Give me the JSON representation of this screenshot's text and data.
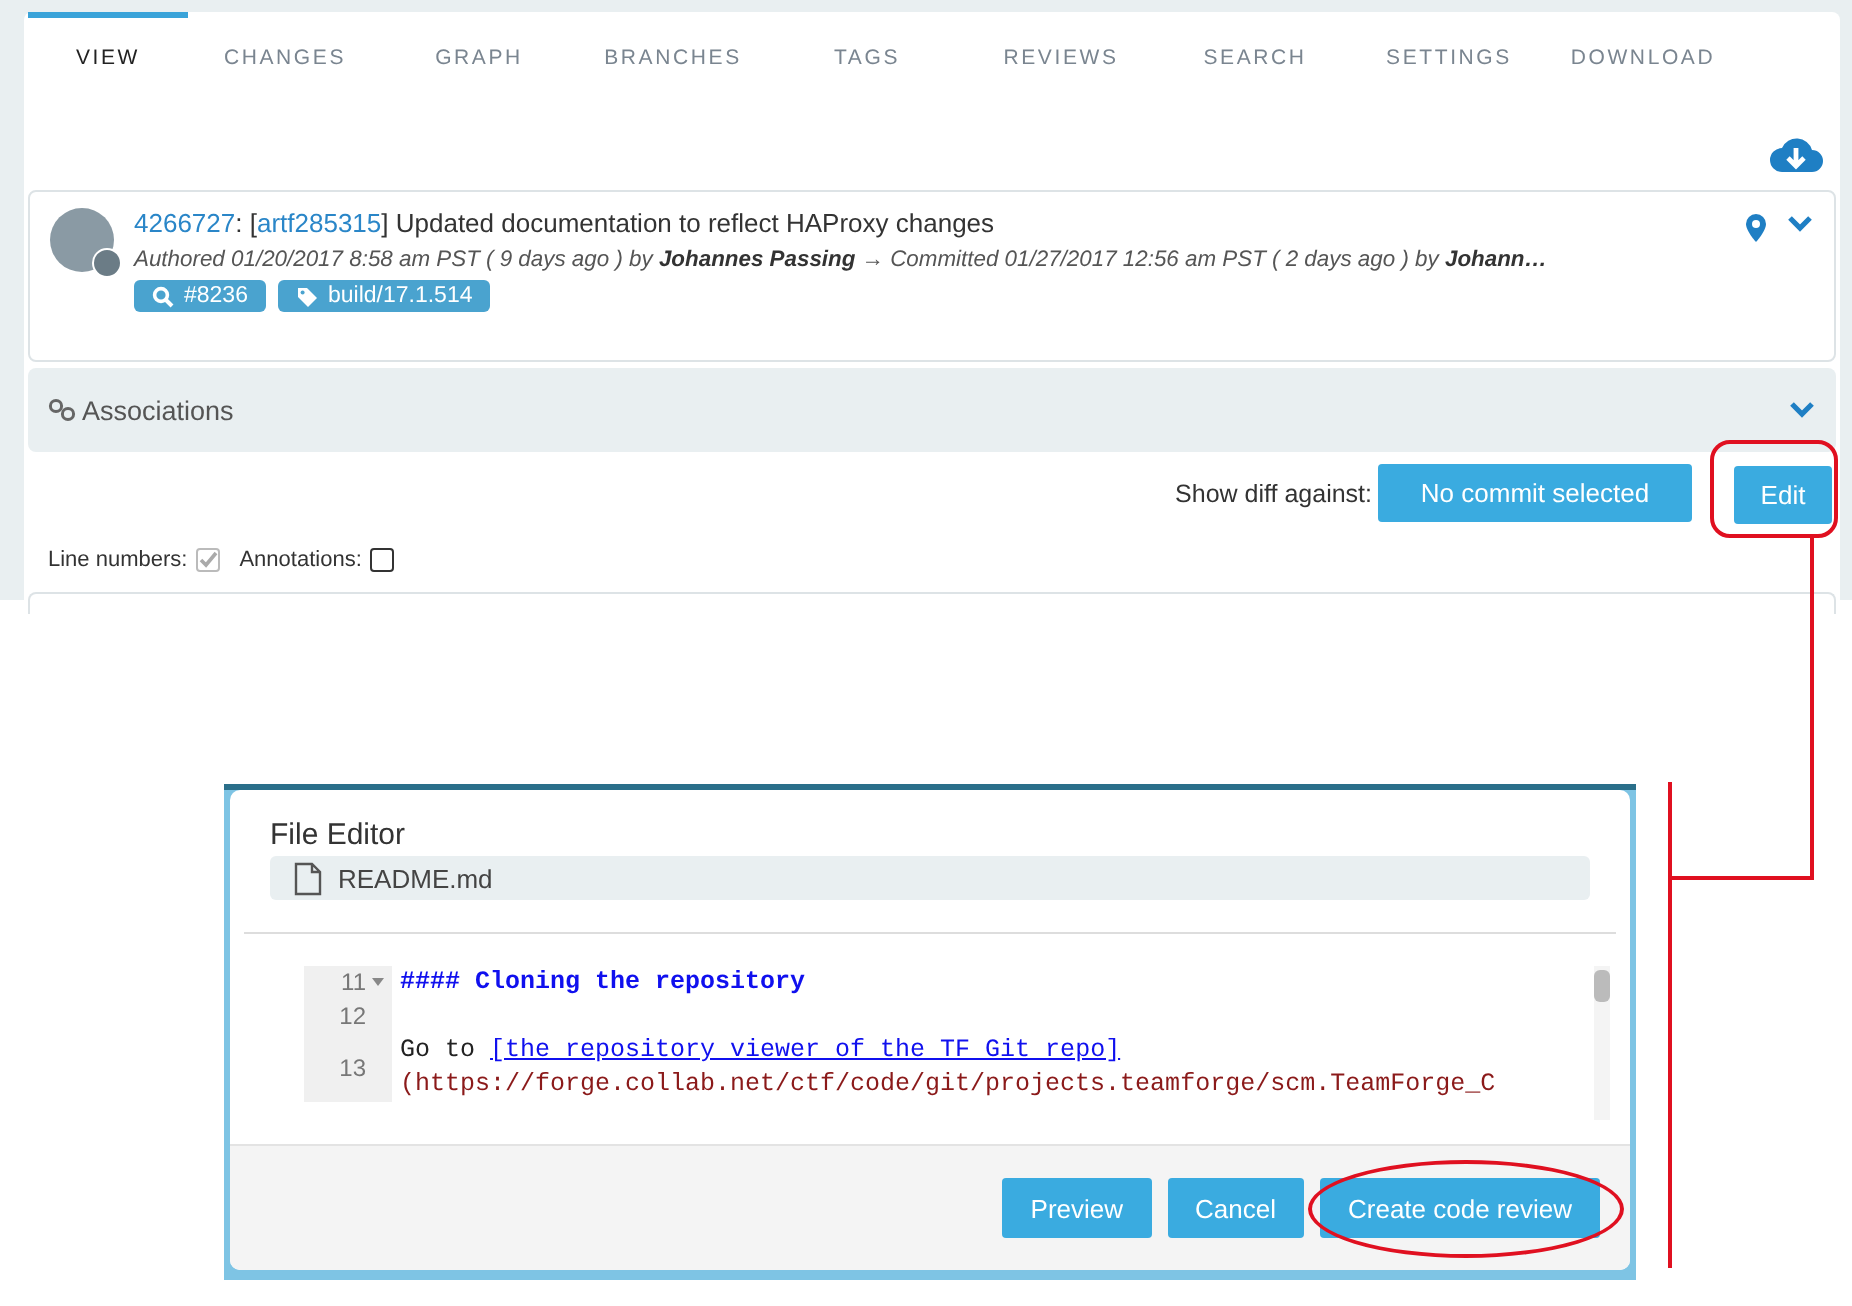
{
  "tabs": [
    {
      "label": "VIEW",
      "selected": true
    },
    {
      "label": "CHANGES",
      "selected": false
    },
    {
      "label": "GRAPH",
      "selected": false
    },
    {
      "label": "BRANCHES",
      "selected": false
    },
    {
      "label": "TAGS",
      "selected": false
    },
    {
      "label": "REVIEWS",
      "selected": false
    },
    {
      "label": "SEARCH",
      "selected": false
    },
    {
      "label": "SETTINGS",
      "selected": false
    },
    {
      "label": "DOWNLOAD",
      "selected": false
    }
  ],
  "commit": {
    "id": "4266727",
    "separator": ": [",
    "artifact": "artf285315",
    "title": "] Updated documentation to reflect HAProxy changes",
    "meta": "Authored  01/20/2017 8:58 am PST ( 9 days ago ) by **Johannes Passing** → Committed 01/27/2017 12:56 am PST ( 2 days ago ) by **Johann…**",
    "tags": [
      {
        "kind": "review",
        "label": "#8236"
      },
      {
        "kind": "tag",
        "label": "build/17.1.514"
      }
    ]
  },
  "associations": {
    "label": "Associations"
  },
  "diff": {
    "label": "Show diff against:",
    "button": "No commit selected"
  },
  "edit_button": "Edit",
  "options": [
    {
      "label": "Line numbers:",
      "checked": true,
      "disabled": true
    },
    {
      "label": "Annotations:",
      "checked": false,
      "disabled": false
    }
  ],
  "editor": {
    "title": "File Editor",
    "file": "README.md",
    "lines": [
      {
        "number": "11",
        "foldable": true,
        "segments": [
          {
            "kind": "heading",
            "text": "#### Cloning the repository"
          }
        ]
      },
      {
        "number": "12",
        "foldable": false
      },
      {
        "number": "13",
        "foldable": false,
        "segments": [
          {
            "kind": "text",
            "text": "Go to "
          },
          {
            "kind": "link",
            "text": "[the repository viewer of the TF Git repo]"
          },
          {
            "kind": "url",
            "text": "(https://forge.collab.net/ctf/code/git/projects.teamforge/scm.TeamForge_C"
          }
        ]
      }
    ],
    "buttons": [
      {
        "label": "Preview"
      },
      {
        "label": "Cancel"
      },
      {
        "label": "Create code review"
      }
    ]
  }
}
